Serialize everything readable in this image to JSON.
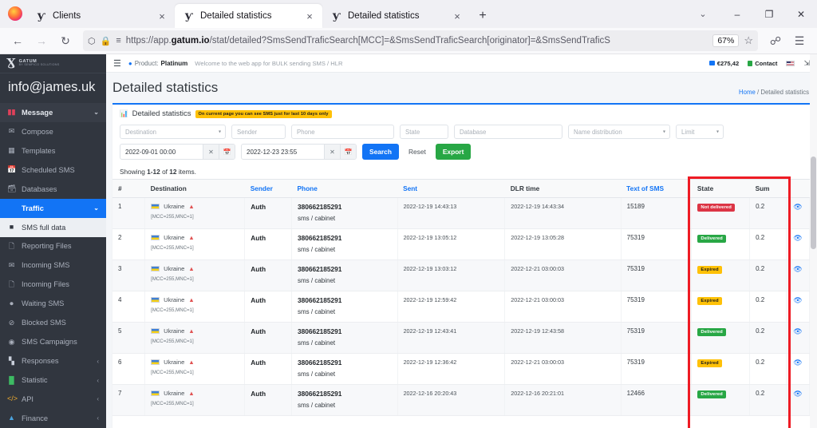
{
  "browser": {
    "tabs": [
      {
        "title": "Clients",
        "favicon": "gatum-logo-icon",
        "active": false,
        "close": "×"
      },
      {
        "title": "Detailed statistics",
        "favicon": "gatum-logo-icon",
        "active": true,
        "close": "×"
      },
      {
        "title": "Detailed statistics",
        "favicon": "gatum-logo-icon",
        "active": false,
        "close": "×"
      }
    ],
    "new_tab_label": "+",
    "tab_list_chevron": "⌄",
    "window_controls": {
      "minimize": "–",
      "maximize": "❐",
      "close": "✕"
    },
    "nav": {
      "back": "←",
      "forward": "→",
      "reload": "↻"
    },
    "url": {
      "shield_icon": "⬡",
      "lock_icon": "🔒",
      "perms_icon": "☰",
      "prefix": "https://app.",
      "domain": "gatum.io",
      "path": "/stat/detailed?SmsSendTraficSearch[MCC]=&SmsSendTraficSearch[originator]=&SmsSendTraficS",
      "zoom_level": "67%",
      "bookmark_icon": "☆"
    },
    "toolbar_right": {
      "pocket_icon": "⬇",
      "menu_icon": "☰"
    }
  },
  "sidebar": {
    "brand": {
      "mark": "Ɣ",
      "line1": "GATUM",
      "line2": "BY SEMPICO SOLUTIONS"
    },
    "user_email": "info@james.uk",
    "items": [
      {
        "label": "Message",
        "icon": "messages-icon",
        "caret": "⌄",
        "state": "group"
      },
      {
        "label": "Compose",
        "icon": "envelope-icon",
        "caret": "",
        "state": "normal"
      },
      {
        "label": "Templates",
        "icon": "template-icon",
        "caret": "",
        "state": "normal"
      },
      {
        "label": "Scheduled SMS",
        "icon": "calendar-icon",
        "caret": "",
        "state": "normal"
      },
      {
        "label": "Databases",
        "icon": "database-icon",
        "caret": "",
        "state": "normal"
      },
      {
        "label": "Traffic",
        "icon": "",
        "caret": "⌄",
        "state": "active"
      },
      {
        "label": "SMS full data",
        "icon": "robot-icon",
        "caret": "",
        "state": "subactive"
      },
      {
        "label": "Reporting Files",
        "icon": "file-report-icon",
        "caret": "",
        "state": "normal"
      },
      {
        "label": "Incoming SMS",
        "icon": "inbox-icon",
        "caret": "",
        "state": "normal"
      },
      {
        "label": "Incoming Files",
        "icon": "file-in-icon",
        "caret": "",
        "state": "normal"
      },
      {
        "label": "Waiting SMS",
        "icon": "clock-icon",
        "caret": "",
        "state": "normal"
      },
      {
        "label": "Blocked SMS",
        "icon": "ban-icon",
        "caret": "",
        "state": "normal"
      },
      {
        "label": "SMS Campaigns",
        "icon": "campaign-icon",
        "caret": "",
        "state": "normal"
      },
      {
        "label": "Responses",
        "icon": "responses-icon",
        "caret": "‹",
        "state": "normal"
      },
      {
        "label": "Statistic",
        "icon": "chart-icon",
        "caret": "‹",
        "state": "normal"
      },
      {
        "label": "API",
        "icon": "code-icon",
        "caret": "‹",
        "state": "normal"
      },
      {
        "label": "Finance",
        "icon": "finance-icon",
        "caret": "‹",
        "state": "normal"
      }
    ]
  },
  "topbar": {
    "burger_icon": "☰",
    "product_label": "Product:",
    "product_value": "Platinum",
    "welcome": "Welcome to the web app for BULK sending SMS / HLR",
    "balance": "€275,42",
    "contact": "Contact",
    "language_flag": "us-flag-icon",
    "logout_icon": "logout-icon"
  },
  "header": {
    "title": "Detailed statistics",
    "breadcrumb_home": "Home",
    "breadcrumb_sep": "/",
    "breadcrumb_current": "Detailed statistics"
  },
  "card": {
    "icon": "bar-chart-icon",
    "title": "Detailed statistics",
    "notice": "On current page you can see SMS just for last 10 days only"
  },
  "filters": {
    "destination": {
      "placeholder": "Destination",
      "value": ""
    },
    "sender": {
      "placeholder": "Sender",
      "value": ""
    },
    "phone": {
      "placeholder": "Phone",
      "value": ""
    },
    "state": {
      "placeholder": "State",
      "value": ""
    },
    "database": {
      "placeholder": "Database",
      "value": ""
    },
    "name_distribution": {
      "placeholder": "Name distribution",
      "value": ""
    },
    "limit": {
      "placeholder": "Limit",
      "value": ""
    },
    "date_from": {
      "value": "2022-09-01 00:00",
      "clear_icon": "✕",
      "calendar_icon": "📅"
    },
    "date_to": {
      "value": "2022-12-23 23:55",
      "clear_icon": "✕",
      "calendar_icon": "📅"
    },
    "search_button": "Search",
    "reset_button": "Reset",
    "export_button": "Export"
  },
  "table": {
    "showing_prefix": "Showing",
    "showing_range": "1-12",
    "showing_of": "of",
    "showing_total": "12",
    "showing_suffix": "items.",
    "columns": [
      {
        "label": "#",
        "link": false
      },
      {
        "label": "Destination",
        "link": false
      },
      {
        "label": "Sender",
        "link": true
      },
      {
        "label": "Phone",
        "link": true
      },
      {
        "label": "Sent",
        "link": true
      },
      {
        "label": "DLR time",
        "link": false
      },
      {
        "label": "Text of SMS",
        "link": true
      },
      {
        "label": "State",
        "link": false
      },
      {
        "label": "Sum",
        "link": false
      },
      {
        "label": "",
        "link": false
      }
    ],
    "rows": [
      {
        "idx": "1",
        "country": "Ukraine",
        "mcc": "[MCC=255,MNC=1]",
        "sender": "Auth",
        "phone": "380662185291",
        "route": "sms / cabinet",
        "sent": "2022-12-19 14:43:13",
        "dlr": "2022-12-19 14:43:34",
        "text": "15189",
        "state": "Not delivered",
        "state_kind": "notdelivered",
        "sum": "0.2",
        "action_icon": "eye-icon"
      },
      {
        "idx": "2",
        "country": "Ukraine",
        "mcc": "[MCC=255,MNC=1]",
        "sender": "Auth",
        "phone": "380662185291",
        "route": "sms / cabinet",
        "sent": "2022-12-19 13:05:12",
        "dlr": "2022-12-19 13:05:28",
        "text": "75319",
        "state": "Delivered",
        "state_kind": "delivered",
        "sum": "0.2",
        "action_icon": "eye-icon"
      },
      {
        "idx": "3",
        "country": "Ukraine",
        "mcc": "[MCC=255,MNC=1]",
        "sender": "Auth",
        "phone": "380662185291",
        "route": "sms / cabinet",
        "sent": "2022-12-19 13:03:12",
        "dlr": "2022-12-21 03:00:03",
        "text": "75319",
        "state": "Expired",
        "state_kind": "expired",
        "sum": "0.2",
        "action_icon": "eye-icon"
      },
      {
        "idx": "4",
        "country": "Ukraine",
        "mcc": "[MCC=255,MNC=1]",
        "sender": "Auth",
        "phone": "380662185291",
        "route": "sms / cabinet",
        "sent": "2022-12-19 12:59:42",
        "dlr": "2022-12-21 03:00:03",
        "text": "75319",
        "state": "Expired",
        "state_kind": "expired",
        "sum": "0.2",
        "action_icon": "eye-icon"
      },
      {
        "idx": "5",
        "country": "Ukraine",
        "mcc": "[MCC=255,MNC=1]",
        "sender": "Auth",
        "phone": "380662185291",
        "route": "sms / cabinet",
        "sent": "2022-12-19 12:43:41",
        "dlr": "2022-12-19 12:43:58",
        "text": "75319",
        "state": "Delivered",
        "state_kind": "delivered",
        "sum": "0.2",
        "action_icon": "eye-icon"
      },
      {
        "idx": "6",
        "country": "Ukraine",
        "mcc": "[MCC=255,MNC=1]",
        "sender": "Auth",
        "phone": "380662185291",
        "route": "sms / cabinet",
        "sent": "2022-12-19 12:36:42",
        "dlr": "2022-12-21 03:00:03",
        "text": "75319",
        "state": "Expired",
        "state_kind": "expired",
        "sum": "0.2",
        "action_icon": "eye-icon"
      },
      {
        "idx": "7",
        "country": "Ukraine",
        "mcc": "[MCC=255,MNC=1]",
        "sender": "Auth",
        "phone": "380662185291",
        "route": "sms / cabinet",
        "sent": "2022-12-16 20:20:43",
        "dlr": "2022-12-16 20:21:01",
        "text": "12466",
        "state": "Delivered",
        "state_kind": "delivered",
        "sum": "0.2",
        "action_icon": "eye-icon"
      }
    ]
  },
  "annotation": {
    "color": "#ee1b24",
    "description": "red-highlight-box-around-state-and-sum-columns"
  }
}
